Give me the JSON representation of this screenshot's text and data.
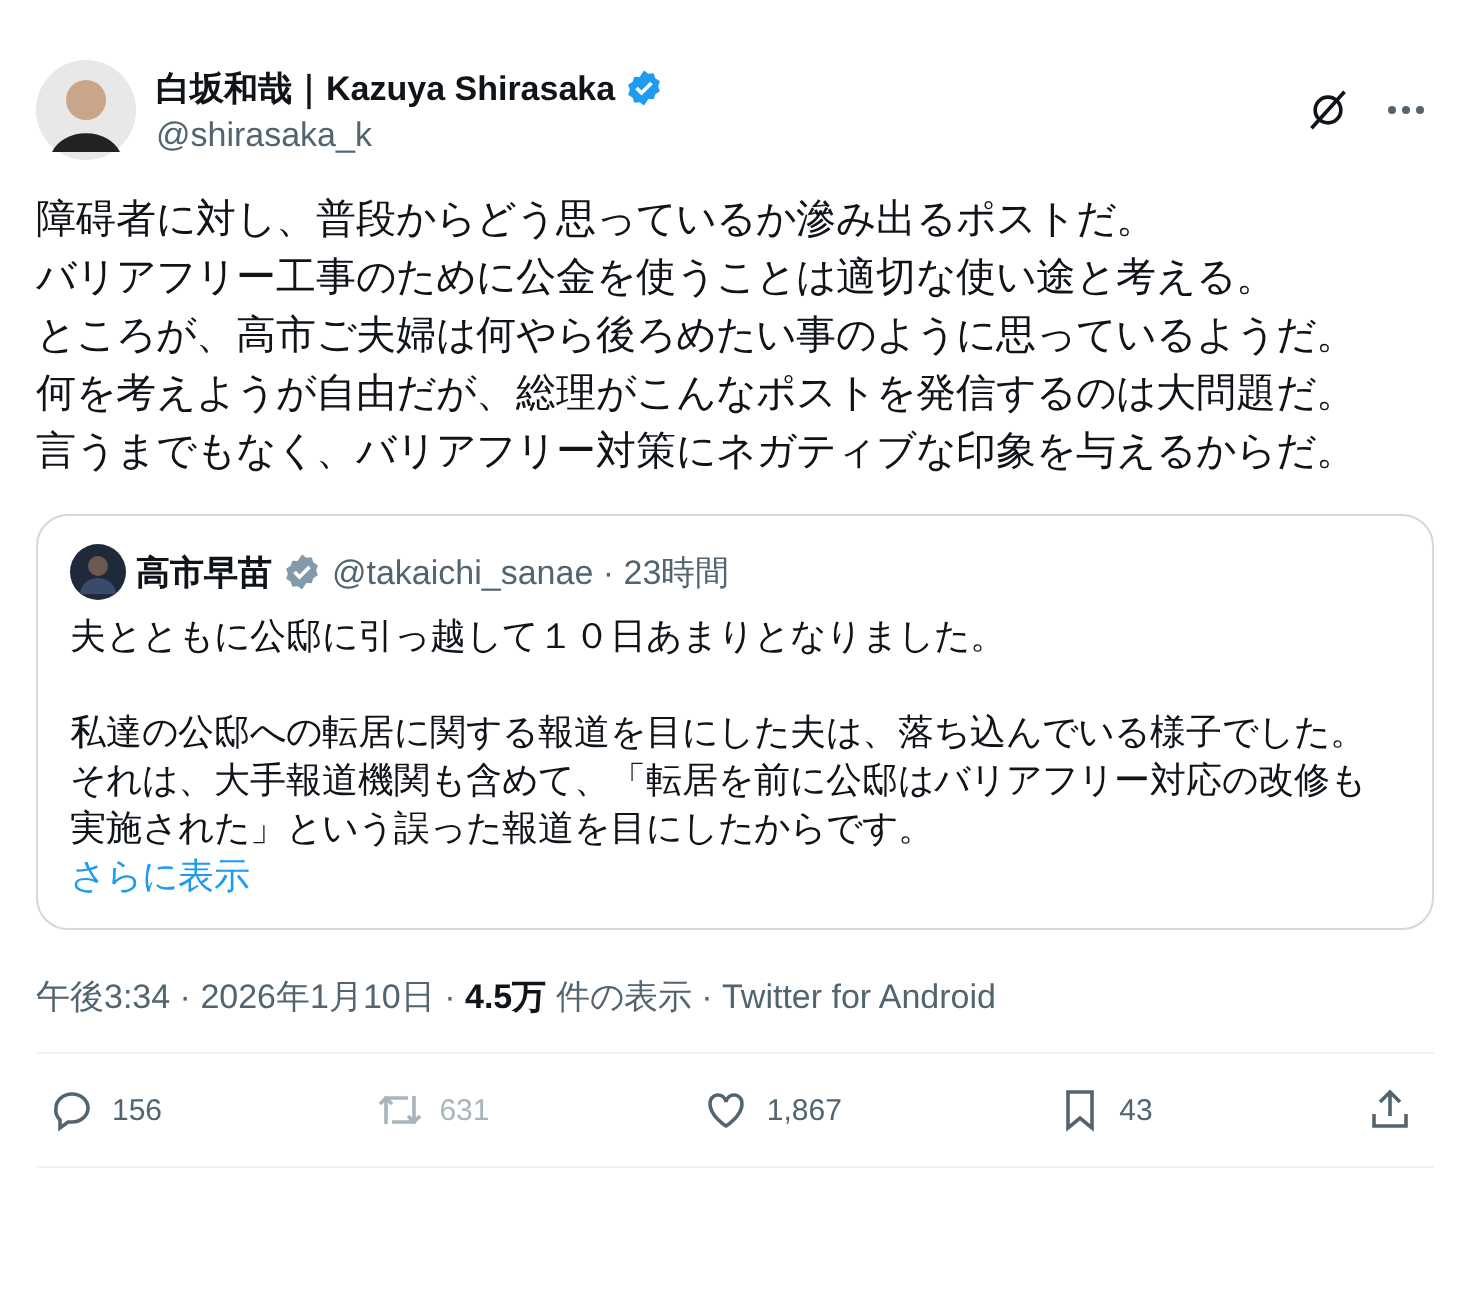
{
  "author": {
    "name": "白坂和哉｜Kazuya Shirasaka",
    "handle": "@shirasaka_k",
    "verified": true
  },
  "body": [
    "障碍者に対し、普段からどう思っているか滲み出るポストだ。",
    "バリアフリー工事のために公金を使うことは適切な使い途と考える。",
    "ところが、高市ご夫婦は何やら後ろめたい事のように思っているようだ。",
    "何を考えようが自由だが、総理がこんなポストを発信するのは大問題だ。",
    "言うまでもなく、バリアフリー対策にネガティブな印象を与えるからだ。"
  ],
  "quote": {
    "name": "高市早苗",
    "verified": true,
    "handle": "@takaichi_sanae · 23時間",
    "paragraphs": [
      "夫とともに公邸に引っ越して１０日あまりとなりました。",
      "私達の公邸への転居に関する報道を目にした夫は、落ち込んでいる様子でした。それは、大手報道機関も含めて、「転居を前に公邸はバリアフリー対応の改修も実施された」という誤った報道を目にしたからです。"
    ],
    "more": "さらに表示"
  },
  "meta": {
    "time": "午後3:34 · 2026年1月10日 · ",
    "views": "4.5万",
    "views_label": " 件の表示 · ",
    "source": "Twitter for Android"
  },
  "actions": [
    {
      "kind": "reply",
      "count": "156",
      "disabled": false
    },
    {
      "kind": "repost",
      "count": "631",
      "disabled": true
    },
    {
      "kind": "like",
      "count": "1,867",
      "disabled": false
    },
    {
      "kind": "bookmark",
      "count": "43",
      "disabled": false
    },
    {
      "kind": "share"
    }
  ]
}
